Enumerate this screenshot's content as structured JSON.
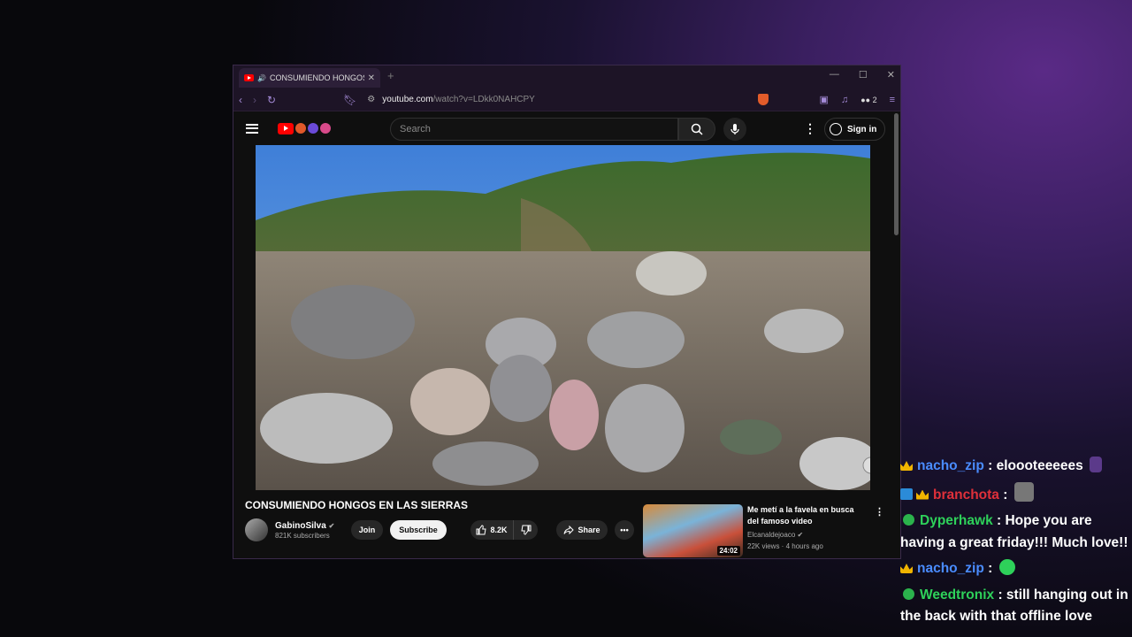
{
  "browser": {
    "tab_title": "CONSUMIENDO HONGOS EN",
    "url_host": "youtube.com",
    "url_path": "/watch?v=LDkk0NAHCPY",
    "extension_badge": "2"
  },
  "youtube": {
    "search_placeholder": "Search",
    "sign_in_label": "Sign in",
    "video_title": "CONSUMIENDO HONGOS EN LAS SIERRAS",
    "channel_name": "GabinoSilva",
    "subscribers": "821K subscribers",
    "join_label": "Join",
    "subscribe_label": "Subscribe",
    "likes": "8.2K",
    "share_label": "Share",
    "recommendation": {
      "title": "Me metí a la favela en busca del famoso video",
      "channel": "Elcanaldejoaco",
      "meta": "22K views · 4 hours ago",
      "duration": "24:02"
    }
  },
  "chat": {
    "messages": [
      {
        "user": "nacho_zip",
        "text": ": eloooteeeees",
        "user_color": "#4a8cff"
      },
      {
        "user": "branchota",
        "text": ":",
        "user_color": "#e0303a"
      },
      {
        "user": "Dyperhawk",
        "text": ": Hope you are having a great friday!!! Much love!!",
        "user_color": "#2ed15a"
      },
      {
        "user": "nacho_zip",
        "text": ":",
        "user_color": "#4a8cff"
      },
      {
        "user": "Weedtronix",
        "text": ": still hanging out in the back with that offline love",
        "user_color": "#2ed15a"
      }
    ]
  },
  "icons": {
    "back": "back-arrow-icon",
    "forward": "forward-arrow-icon",
    "reload": "reload-icon",
    "bookmark": "bookmark-icon",
    "search": "search-icon",
    "mic": "microphone-icon",
    "like": "thumbs-up-icon",
    "dislike": "thumbs-down-icon",
    "share": "share-icon"
  },
  "colors": {
    "youtube_red": "#ff0000",
    "browser_accent": "#a58bd8",
    "crown_gold": "#f0b400"
  }
}
